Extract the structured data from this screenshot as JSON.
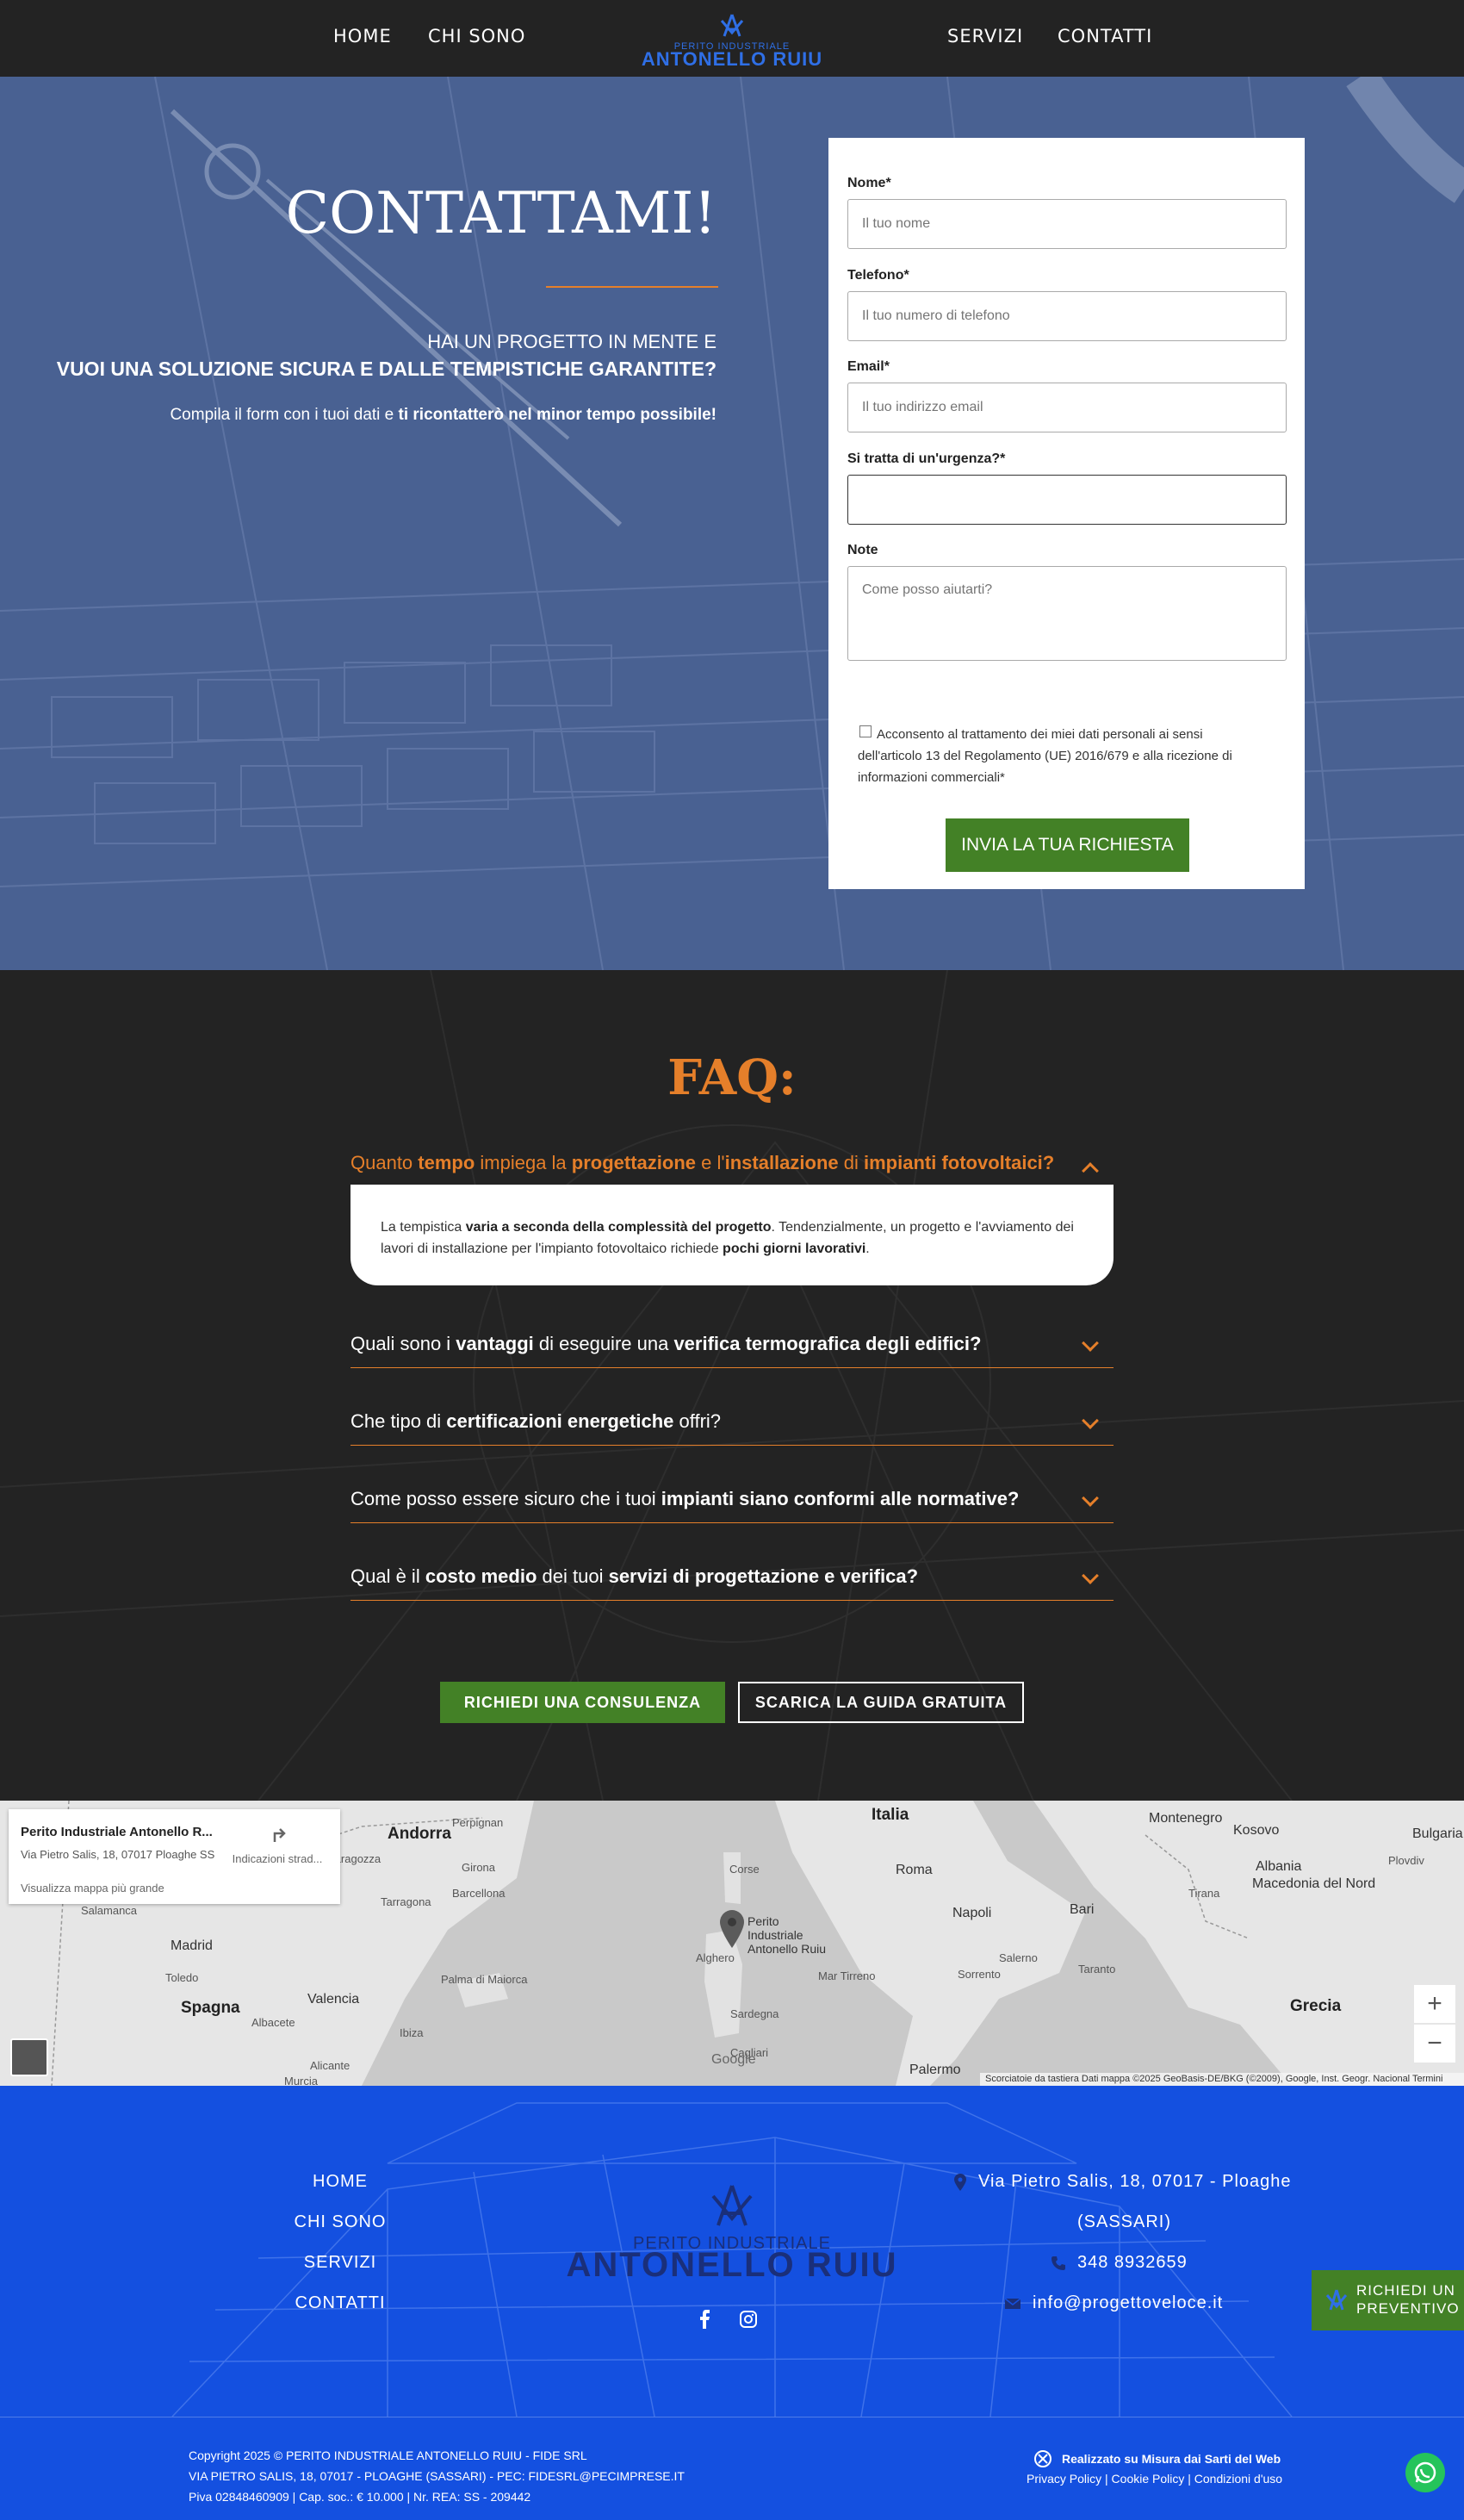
{
  "nav": {
    "home": "HOME",
    "about": "CHI SONO",
    "services": "SERVIZI",
    "contact": "CONTATTI",
    "logo_line1": "PERITO INDUSTRIALE",
    "logo_line2": "ANTONELLO RUIU"
  },
  "hero": {
    "title": "CONTATTAMI!",
    "subtitle1": "HAI UN PROGETTO IN MENTE E",
    "subtitle2": "VUOI UNA SOLUZIONE SICURA E DALLE TEMPISTICHE GARANTITE?",
    "text_plain": "Compila il form con i tuoi dati e ",
    "text_bold": "ti ricontatterò nel minor tempo possibile!"
  },
  "form": {
    "name_label": "Nome*",
    "name_placeholder": "Il tuo nome",
    "phone_label": "Telefono*",
    "phone_placeholder": "Il tuo numero di telefono",
    "email_label": "Email*",
    "email_placeholder": "Il tuo indirizzo email",
    "urgency_label": "Si tratta di un'urgenza?*",
    "notes_label": "Note",
    "notes_placeholder": "Come posso aiutarti?",
    "consent": "Acconsento al trattamento dei miei dati personali ai sensi dell'articolo 13 del Regolamento (UE) 2016/679 e alla ricezione di informazioni commerciali*",
    "submit": "INVIA LA TUA RICHIESTA"
  },
  "faq": {
    "title": "FAQ:",
    "items": [
      {
        "parts": [
          {
            "t": "Quanto ",
            "b": false
          },
          {
            "t": "tempo",
            "b": true
          },
          {
            "t": " impiega la ",
            "b": false
          },
          {
            "t": "progettazione",
            "b": true
          },
          {
            "t": " e l'",
            "b": false
          },
          {
            "t": "installazione",
            "b": true
          },
          {
            "t": " di ",
            "b": false
          },
          {
            "t": "impianti fotovoltaici?",
            "b": true
          }
        ],
        "answer": [
          {
            "t": "La tempistica ",
            "b": false
          },
          {
            "t": "varia a seconda della complessità del progetto",
            "b": true
          },
          {
            "t": ". Tendenzialmente, un progetto e l'avviamento dei lavori di installazione per l'impianto fotovoltaico richiede ",
            "b": false
          },
          {
            "t": "pochi giorni lavorativi",
            "b": true
          },
          {
            "t": ".",
            "b": false
          }
        ]
      },
      {
        "parts": [
          {
            "t": "Quali sono i ",
            "b": false
          },
          {
            "t": "vantaggi",
            "b": true
          },
          {
            "t": " di eseguire una ",
            "b": false
          },
          {
            "t": "verifica termografica degli edifici?",
            "b": true
          }
        ]
      },
      {
        "parts": [
          {
            "t": "Che tipo di ",
            "b": false
          },
          {
            "t": "certificazioni energetiche",
            "b": true
          },
          {
            "t": " offri?",
            "b": false
          }
        ]
      },
      {
        "parts": [
          {
            "t": "Come posso essere sicuro che i tuoi ",
            "b": false
          },
          {
            "t": "impianti siano conformi alle normative?",
            "b": true
          }
        ]
      },
      {
        "parts": [
          {
            "t": "Qual è il ",
            "b": false
          },
          {
            "t": "costo medio",
            "b": true
          },
          {
            "t": " dei tuoi ",
            "b": false
          },
          {
            "t": "servizi di progettazione e verifica?",
            "b": true
          }
        ]
      }
    ],
    "cta_consult": "RICHIEDI UNA CONSULENZA",
    "cta_guide": "SCARICA LA GUIDA GRATUITA"
  },
  "map": {
    "place_title": "Perito Industriale Antonello R...",
    "place_address": "Via Pietro Salis, 18, 07017 Ploaghe SS",
    "directions": "Indicazioni strad...",
    "larger_map": "Visualizza mappa più grande",
    "pin_label": "Perito Industriale Antonello Ruiu",
    "zoom_in": "+",
    "zoom_out": "−",
    "google": "Google",
    "attribution": "Scorciatoie da tastiera    Dati mappa ©2025 GeoBasis-DE/BKG (©2009), Google, Inst. Geogr. Nacional    Termini",
    "labels": [
      {
        "t": "Andorra",
        "c": "lbl big"
      },
      {
        "t": "Italia",
        "c": "lbl big"
      },
      {
        "t": "Roma",
        "c": "lbl"
      },
      {
        "t": "Napoli",
        "c": "lbl"
      },
      {
        "t": "Bari",
        "c": "lbl"
      },
      {
        "t": "Madrid",
        "c": "lbl"
      },
      {
        "t": "Spagna",
        "c": "lbl big"
      },
      {
        "t": "Valencia",
        "c": "lbl"
      },
      {
        "t": "Palma di Maiorca",
        "c": "lbl sm"
      },
      {
        "t": "Montenegro",
        "c": "lbl"
      },
      {
        "t": "Kosovo",
        "c": "lbl"
      },
      {
        "t": "Albania",
        "c": "lbl"
      },
      {
        "t": "Macedonia del Nord",
        "c": "lbl"
      },
      {
        "t": "Grecia",
        "c": "lbl big"
      },
      {
        "t": "Bulgaria",
        "c": "lbl"
      },
      {
        "t": "Plovdiv",
        "c": "lbl sm"
      },
      {
        "t": "Girona",
        "c": "lbl sm"
      },
      {
        "t": "Barcellona",
        "c": "lbl sm"
      },
      {
        "t": "Tarragona",
        "c": "lbl sm"
      },
      {
        "t": "Saragozza",
        "c": "lbl sm"
      },
      {
        "t": "Salamanca",
        "c": "lbl sm"
      },
      {
        "t": "Toledo",
        "c": "lbl sm"
      },
      {
        "t": "Albacete",
        "c": "lbl sm"
      },
      {
        "t": "Alicante",
        "c": "lbl sm"
      },
      {
        "t": "Murcia",
        "c": "lbl sm"
      },
      {
        "t": "Ibiza",
        "c": "lbl sm"
      },
      {
        "t": "Corse",
        "c": "lbl sm"
      },
      {
        "t": "Alghero",
        "c": "lbl sm"
      },
      {
        "t": "Sardegna",
        "c": "lbl sm"
      },
      {
        "t": "Cagliari",
        "c": "lbl sm"
      },
      {
        "t": "Mar Tirreno",
        "c": "lbl sm"
      },
      {
        "t": "Palermo",
        "c": "lbl"
      },
      {
        "t": "Salerno",
        "c": "lbl sm"
      },
      {
        "t": "Sorrento",
        "c": "lbl sm"
      },
      {
        "t": "Taranto",
        "c": "lbl sm"
      },
      {
        "t": "Tirana",
        "c": "lbl sm"
      },
      {
        "t": "Perpignan",
        "c": "lbl sm"
      }
    ]
  },
  "footer": {
    "home": "HOME",
    "about": "CHI SONO",
    "services": "SERVIZI",
    "contact": "CONTATTI",
    "logo_line1": "PERITO INDUSTRIALE",
    "logo_line2": "ANTONELLO RUIU",
    "address1": "Via Pietro Salis, 18, 07017 - Ploaghe",
    "address2": "(SASSARI)",
    "phone": "348 8932659",
    "email": "info@progettoveloce.it",
    "preventivo": "RICHIEDI UN PREVENTIVO"
  },
  "bottom": {
    "copy1": "Copyright 2025 © PERITO INDUSTRIALE ANTONELLO RUIU - FIDE SRL",
    "copy2": "VIA PIETRO SALIS, 18, 07017 - PLOAGHE (SASSARI) - PEC: FIDESRL@PECIMPRESE.IT",
    "copy3": "Piva 02848460909 | Cap. soc.: € 10.000 | Nr. REA: SS - 209442",
    "made": "Realizzato su Misura dai Sarti del Web",
    "links": "Privacy Policy | Cookie Policy | Condizioni d'uso"
  },
  "colors": {
    "accent_orange": "#e57f2a",
    "green": "#438126",
    "footer_blue": "#1450e0",
    "dark": "#232323"
  }
}
